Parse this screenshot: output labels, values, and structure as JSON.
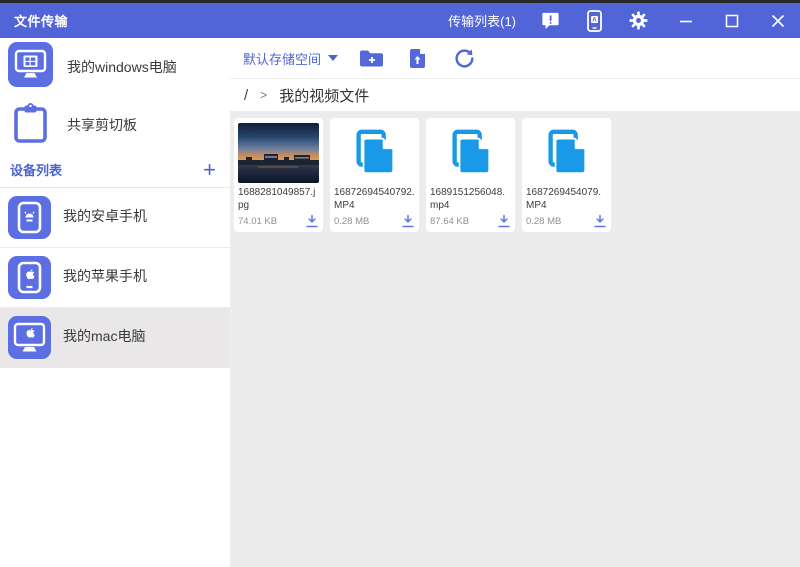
{
  "titlebar": {
    "title": "文件传输",
    "transfer_list": "传输列表(1)",
    "phone_icon_letter": "A"
  },
  "sidebar": {
    "top_items": [
      {
        "label": "我的windows电脑",
        "icon": "windows-pc-icon"
      },
      {
        "label": "共享剪切板",
        "icon": "clipboard-icon"
      }
    ],
    "devices_header": {
      "label": "设备列表",
      "add": "+"
    },
    "devices": [
      {
        "label": "我的安卓手机",
        "icon": "android-phone-icon",
        "selected": false
      },
      {
        "label": "我的苹果手机",
        "icon": "apple-phone-icon",
        "selected": false
      },
      {
        "label": "我的mac电脑",
        "icon": "mac-computer-icon",
        "selected": true
      }
    ]
  },
  "toolbar": {
    "storage_selector": "默认存储空间"
  },
  "breadcrumb": {
    "root": "/",
    "separator": ">",
    "current": "我的视频文件"
  },
  "files": [
    {
      "name": "1688281049857.jpg",
      "size": "74.01 KB",
      "kind": "image"
    },
    {
      "name": "16872694540792.MP4",
      "size": "0.28 MB",
      "kind": "video"
    },
    {
      "name": "1689151256048.mp4",
      "size": "87.64 KB",
      "kind": "video"
    },
    {
      "name": "1687269454079.MP4",
      "size": "0.28 MB",
      "kind": "video"
    }
  ],
  "colors": {
    "titlebar_bg": "#5265d8",
    "accent_indigo": "#4d63d4",
    "sidebar_icon_fill": "#5b6ee2",
    "file_icon_blue": "#189ae8",
    "selected_row_bg": "#e9e7e7",
    "content_bg": "#edecec"
  }
}
